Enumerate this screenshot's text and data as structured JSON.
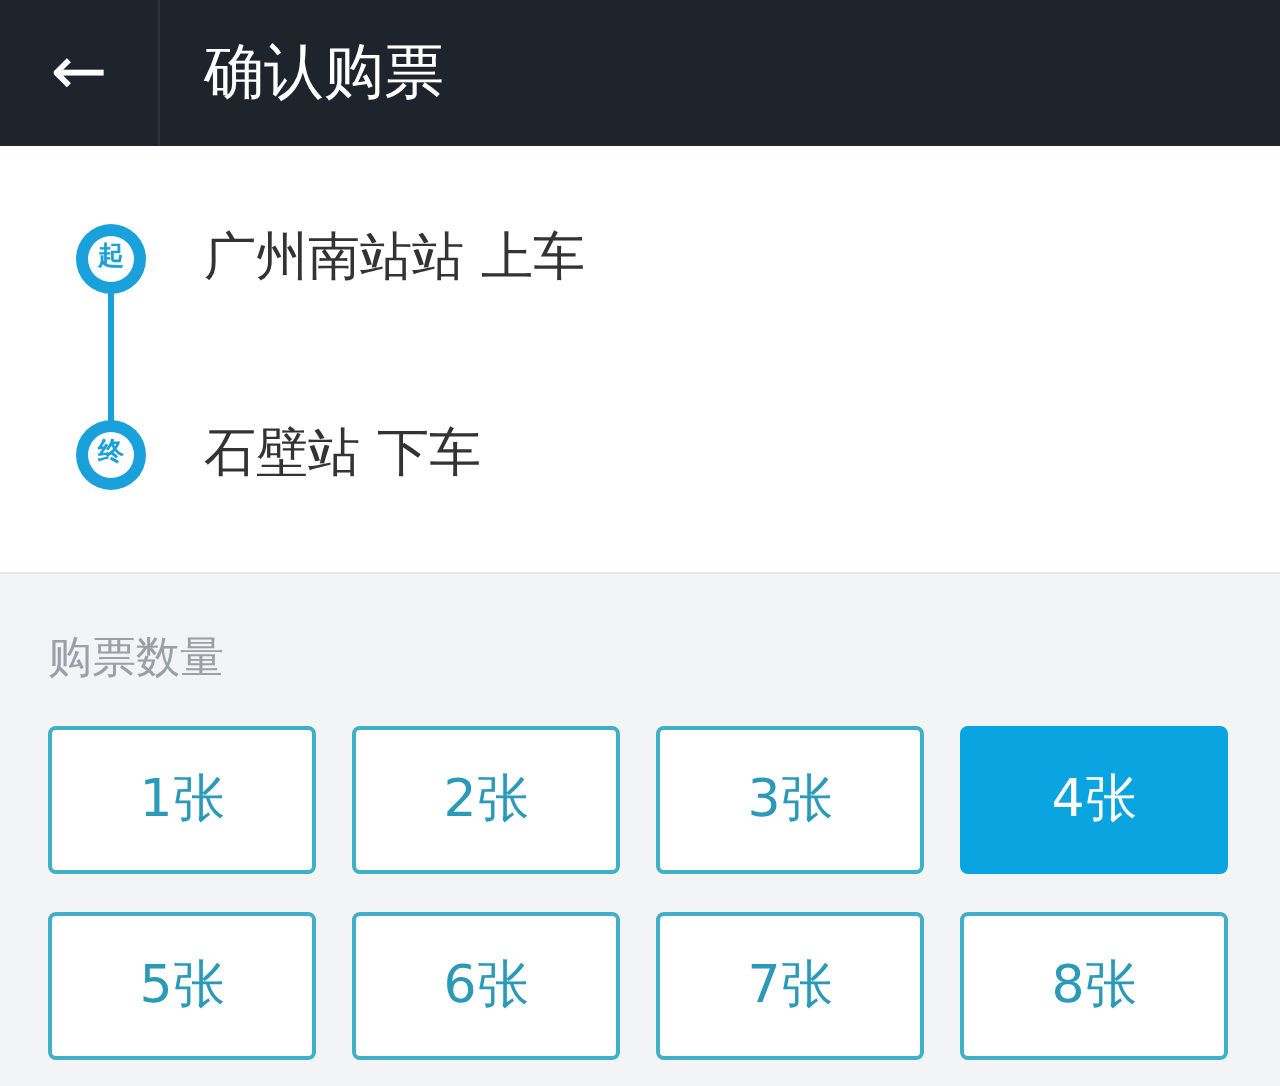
{
  "header": {
    "back_icon": "←",
    "title": "确认购票"
  },
  "route": {
    "stops": [
      {
        "badge": "起",
        "label": "广州南站站 上车"
      },
      {
        "badge": "终",
        "label": "石壁站 下车"
      }
    ]
  },
  "quantity": {
    "label": "购票数量",
    "options": [
      {
        "label": "1张",
        "selected": false
      },
      {
        "label": "2张",
        "selected": false
      },
      {
        "label": "3张",
        "selected": false
      },
      {
        "label": "4张",
        "selected": true
      },
      {
        "label": "5张",
        "selected": false
      },
      {
        "label": "6张",
        "selected": false
      },
      {
        "label": "7张",
        "selected": false
      },
      {
        "label": "8张",
        "selected": false
      }
    ]
  }
}
